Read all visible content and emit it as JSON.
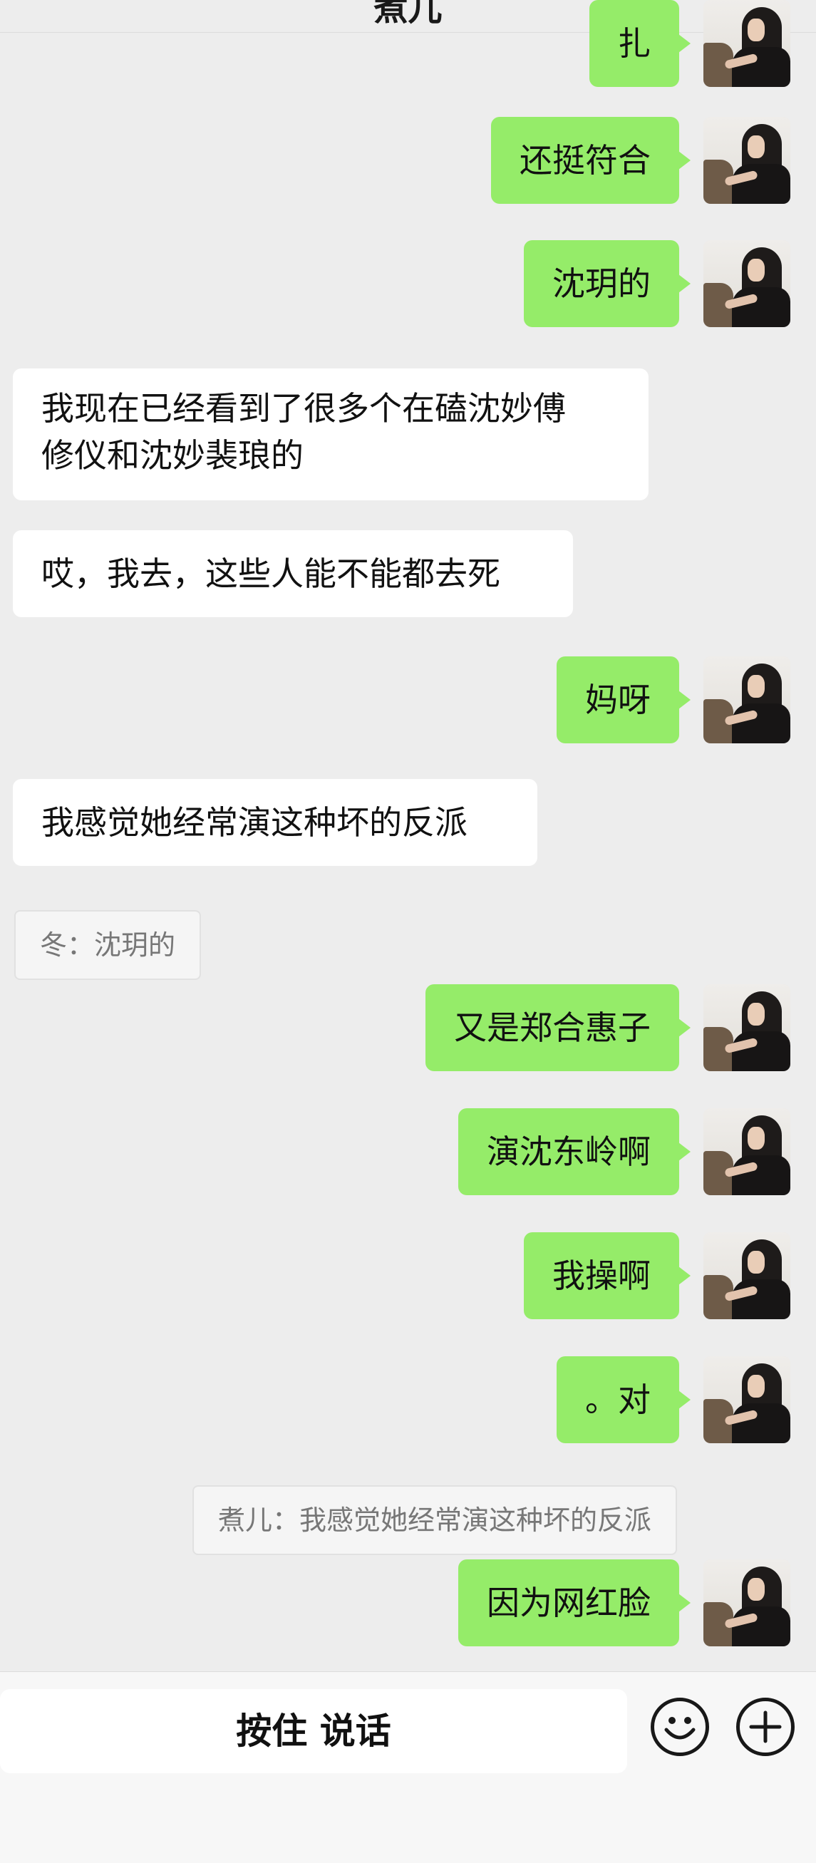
{
  "header": {
    "title": "煮儿"
  },
  "messages": [
    {
      "side": "out",
      "text": "扎"
    },
    {
      "side": "out",
      "text": "还挺符合"
    },
    {
      "side": "out",
      "text": "沈玥的"
    },
    {
      "side": "in",
      "lines": [
        "我现在已经看到了很多个在磕沈妙傅",
        "修仪和沈妙裴琅的"
      ]
    },
    {
      "side": "in",
      "text": "哎，我去，这些人能不能都去死"
    },
    {
      "side": "out",
      "text": "妈呀"
    },
    {
      "side": "in",
      "text": "我感觉她经常演这种坏的反派",
      "quote": "冬：沈玥的"
    },
    {
      "side": "out",
      "text": "又是郑合惠子"
    },
    {
      "side": "out",
      "text": "演沈东岭啊"
    },
    {
      "side": "out",
      "text": "我操啊"
    },
    {
      "side": "out",
      "text": "。对",
      "quote": "煮儿：我感觉她经常演这种坏的反派"
    },
    {
      "side": "out",
      "text": "因为网红脸"
    }
  ],
  "input_bar": {
    "hold_to_talk_label": "按住 说话",
    "emoji_icon": "smiley-face-icon",
    "more_icon": "plus-circle-icon"
  }
}
